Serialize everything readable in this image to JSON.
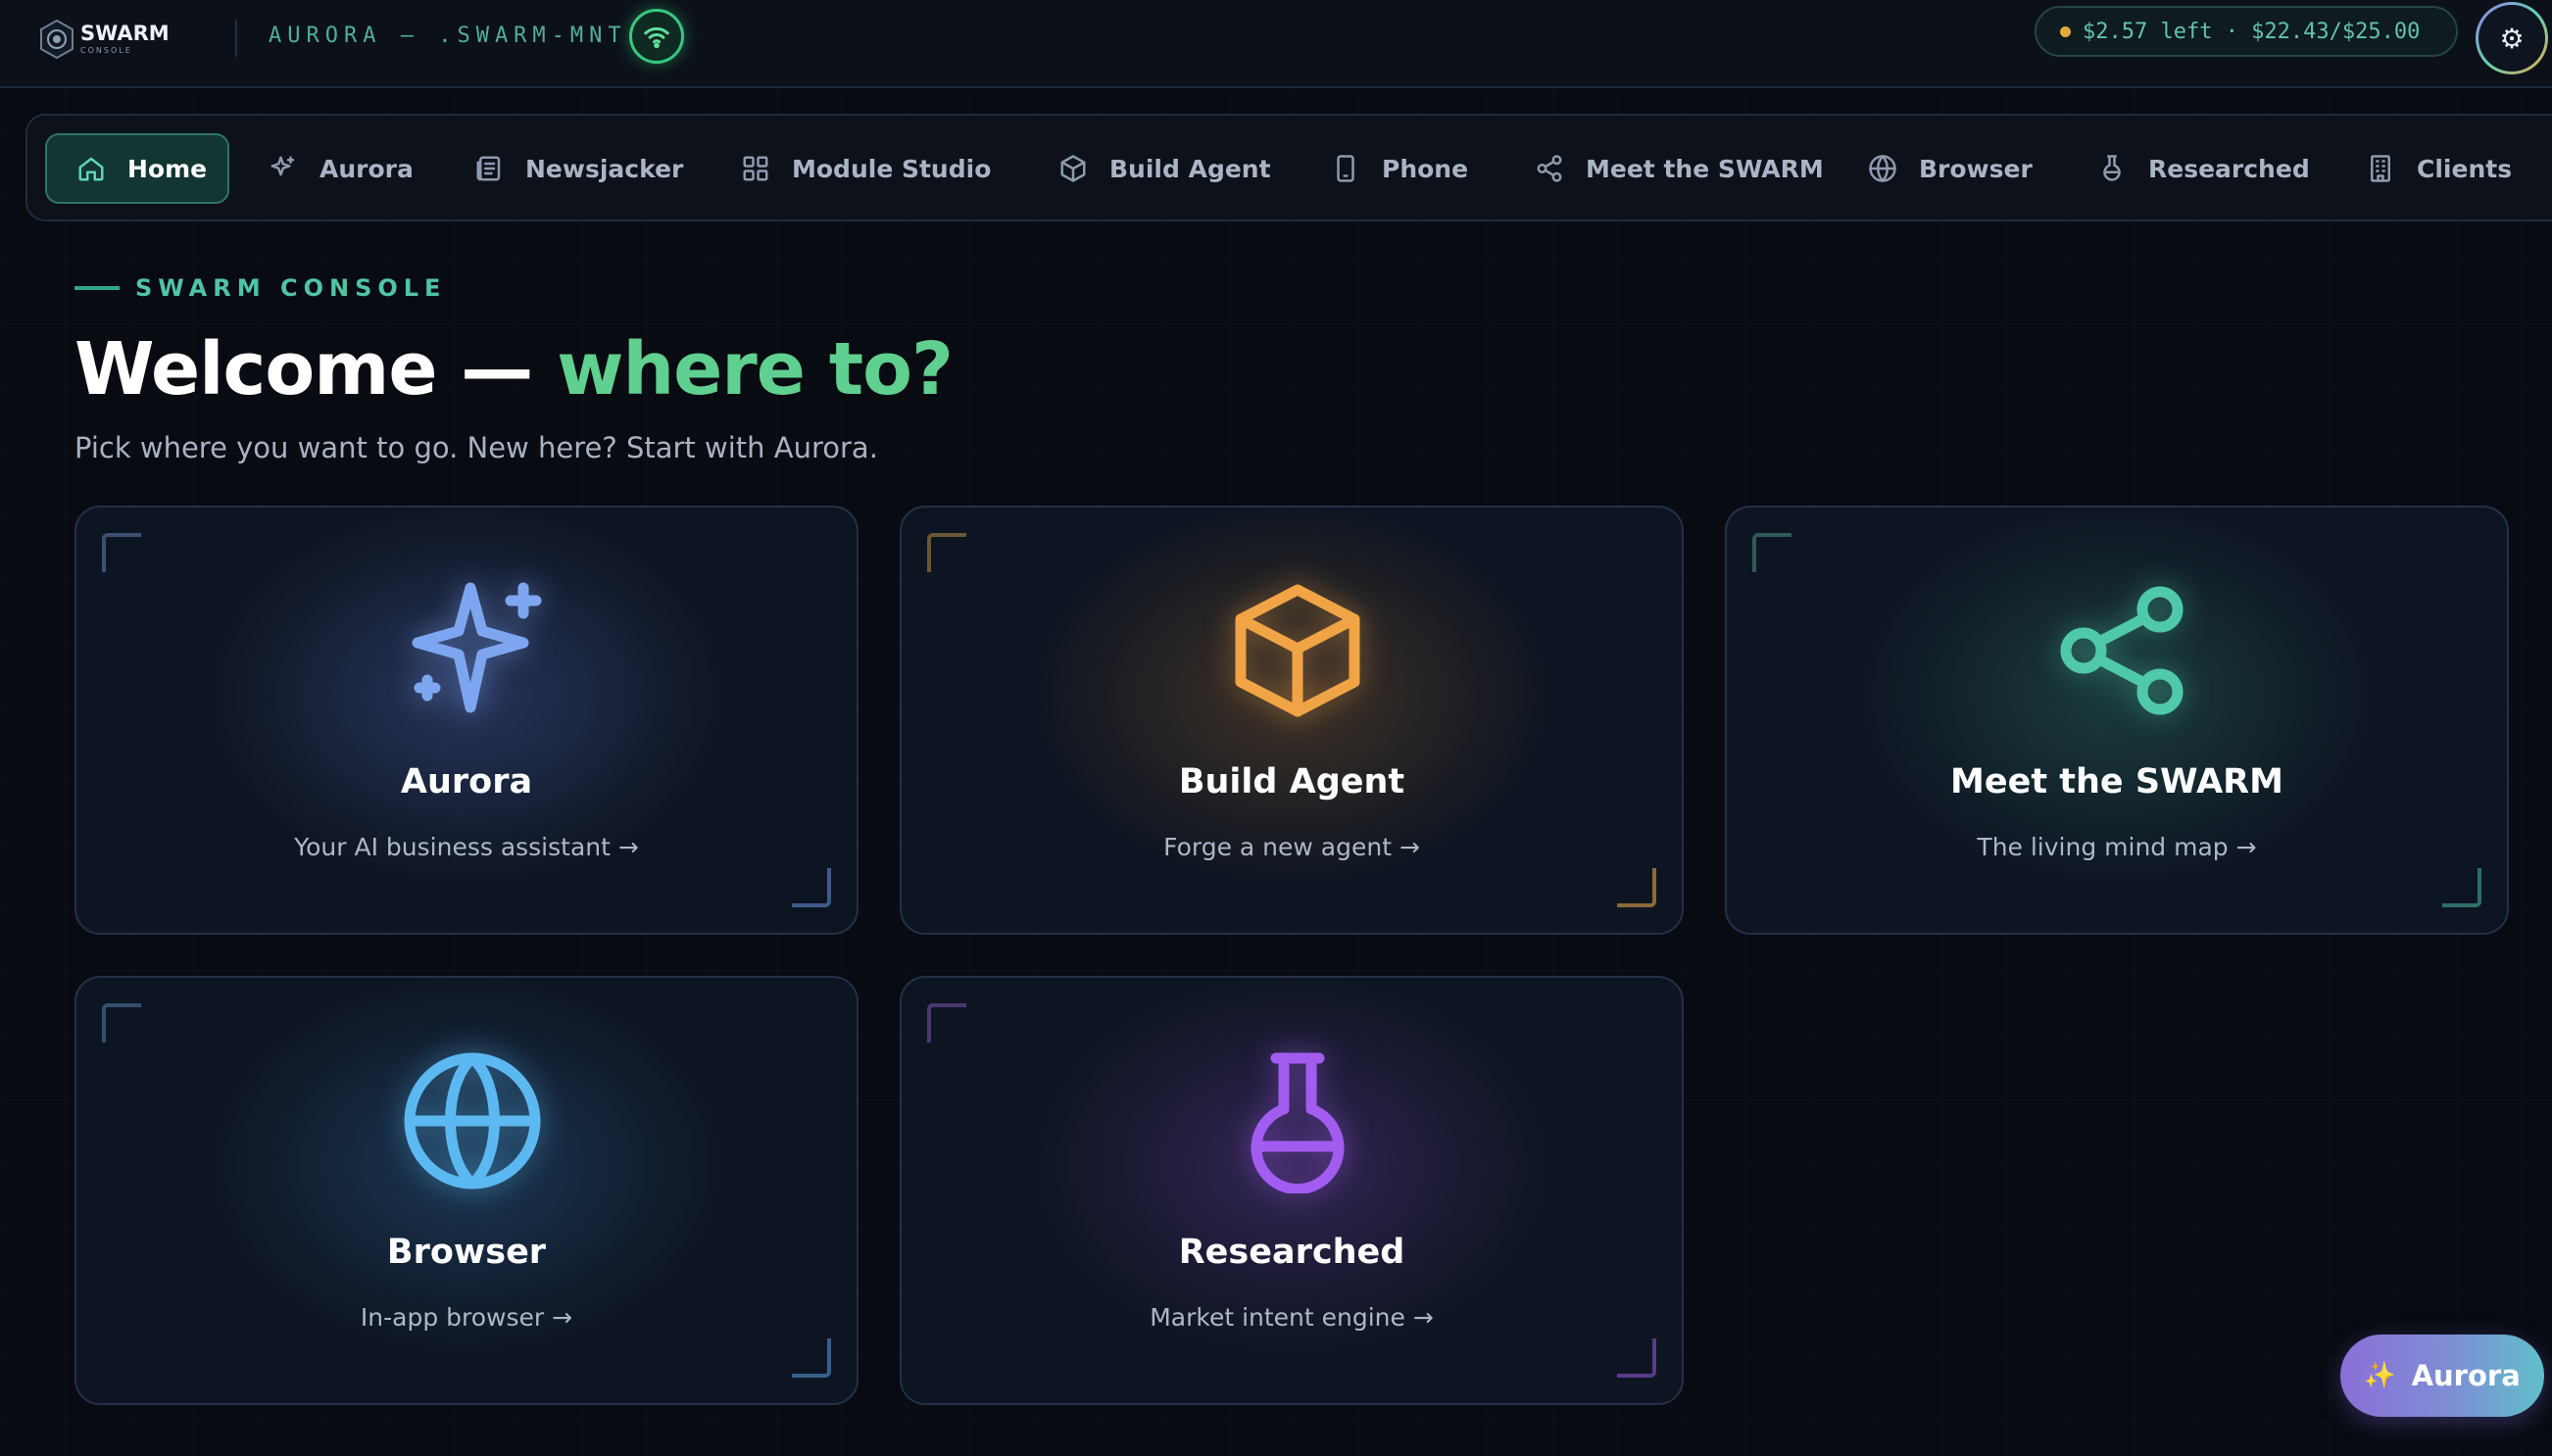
{
  "header": {
    "logo_text": "SWARM",
    "logo_sub": "CONSOLE",
    "node_name": "AURORA — .SWARM-MNT",
    "budget_text": "$2.57 left · $22.43/$25.00",
    "settings_icon": "⚙"
  },
  "nav": {
    "items": [
      {
        "label": "Home",
        "icon": "home-icon"
      },
      {
        "label": "Aurora",
        "icon": "sparkle-icon"
      },
      {
        "label": "Newsjacker",
        "icon": "newspaper-icon"
      },
      {
        "label": "Module Studio",
        "icon": "grid-icon"
      },
      {
        "label": "Build Agent",
        "icon": "cube-icon"
      },
      {
        "label": "Phone",
        "icon": "phone-icon"
      },
      {
        "label": "Meet the SWARM",
        "icon": "share-icon"
      },
      {
        "label": "Browser",
        "icon": "globe-icon"
      },
      {
        "label": "Researched",
        "icon": "flask-icon"
      },
      {
        "label": "Clients",
        "icon": "building-icon"
      }
    ]
  },
  "hero": {
    "eyebrow": "SWARM CONSOLE",
    "title_main": "Welcome — ",
    "title_accent": "where to?",
    "subtitle": "Pick where you want to go. New here? Start with Aurora."
  },
  "cards": [
    {
      "title": "Aurora",
      "desc": "Your AI business assistant →",
      "icon": "sparkle-icon",
      "color": "#7ea6f0"
    },
    {
      "title": "Build Agent",
      "desc": "Forge a new agent →",
      "icon": "cube-icon",
      "color": "#f0a445"
    },
    {
      "title": "Meet the SWARM",
      "desc": "The living mind map →",
      "icon": "share-icon",
      "color": "#4fc9a8"
    },
    {
      "title": "Browser",
      "desc": "In-app browser →",
      "icon": "globe-icon",
      "color": "#5cb8f0"
    },
    {
      "title": "Researched",
      "desc": "Market intent engine →",
      "icon": "flask-icon",
      "color": "#a35cf0"
    }
  ],
  "fab": {
    "label": "Aurora",
    "icon": "✨"
  },
  "colors": {
    "accent": "#5fd4b3",
    "title_accent": "#5fd08f",
    "background": "#080b11"
  }
}
